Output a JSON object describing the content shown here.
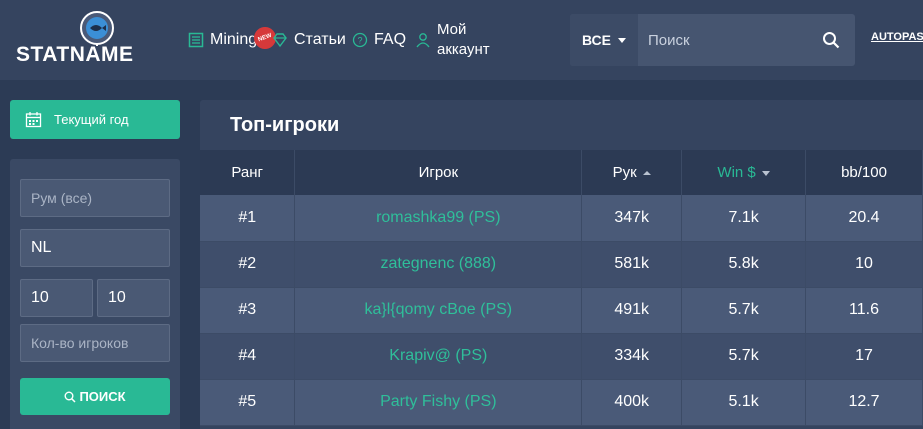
{
  "logo": {
    "text": "STATNAME"
  },
  "nav": {
    "mining": "Mining",
    "new_badge": "NEW",
    "articles": "Статьи",
    "faq": "FAQ",
    "account_line1": "Мой",
    "account_line2": "аккаунт"
  },
  "search": {
    "scope": "ВСЕ",
    "placeholder": "Поиск"
  },
  "autopast": "AUTOPAST",
  "sidebar": {
    "year_button": "Текущий год",
    "room_placeholder": "Рум (все)",
    "limit_value": "NL",
    "min_value": "10",
    "max_value": "10",
    "players_placeholder": "Кол-во игроков",
    "search_button": "ПОИСК"
  },
  "main": {
    "title": "Топ-игроки",
    "columns": [
      "Ранг",
      "Игрок",
      "Рук",
      "Win $",
      "bb/100"
    ],
    "rows": [
      {
        "rank": "#1",
        "player": "romashka99 (PS)",
        "hands": "347k",
        "win": "7.1k",
        "bb": "20.4"
      },
      {
        "rank": "#2",
        "player": "zategnenc (888)",
        "hands": "581k",
        "win": "5.8k",
        "bb": "10"
      },
      {
        "rank": "#3",
        "player": "ka}l{qomy cBoe (PS)",
        "hands": "491k",
        "win": "5.7k",
        "bb": "11.6"
      },
      {
        "rank": "#4",
        "player": "Krapiv@ (PS)",
        "hands": "334k",
        "win": "5.7k",
        "bb": "17"
      },
      {
        "rank": "#5",
        "player": "Party Fishy (PS)",
        "hands": "400k",
        "win": "5.1k",
        "bb": "12.7"
      }
    ]
  },
  "colors": {
    "accent": "#29b995",
    "header_bg": "#35445f",
    "page_bg": "#2c3b55"
  }
}
